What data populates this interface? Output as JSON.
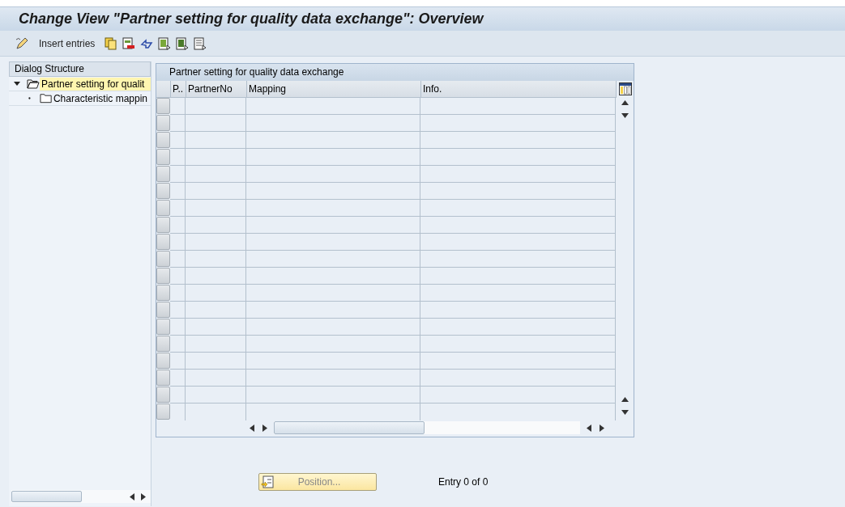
{
  "window": {
    "title": "Change View \"Partner setting for quality data exchange\": Overview"
  },
  "toolbar": {
    "insert_button": {
      "label": "Insert entries"
    }
  },
  "dialog_structure": {
    "title": "Dialog Structure",
    "items": [
      {
        "label": "Partner setting for qualit",
        "selected": true,
        "expanded": true,
        "children": [
          {
            "label": "Characteristic mappin",
            "selected": false
          }
        ]
      }
    ]
  },
  "table": {
    "title": "Partner setting for quality data exchange",
    "columns": [
      "P..",
      "PartnerNo",
      "Mapping",
      "Info."
    ]
  },
  "position_button": {
    "label": "Position...",
    "disabled": true
  },
  "entry_info": "Entry 0 of 0"
}
